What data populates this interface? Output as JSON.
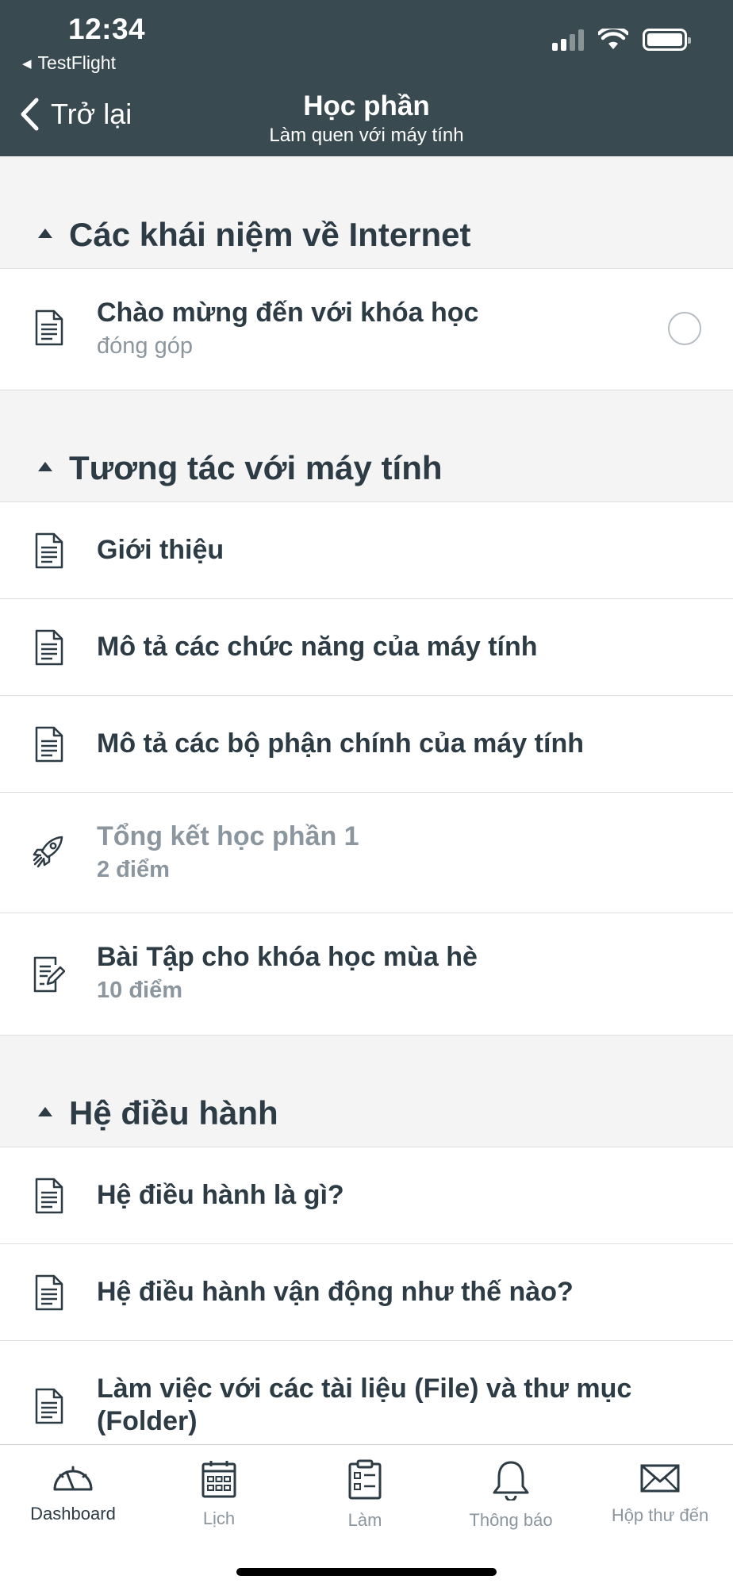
{
  "status_bar": {
    "time": "12:34",
    "back_app": "TestFlight"
  },
  "nav": {
    "back_label": "Trở lại",
    "title": "Học phần",
    "subtitle": "Làm quen với máy tính"
  },
  "sections": [
    {
      "title": "Các khái niệm về Internet",
      "items": [
        {
          "title": "Chào mừng đến với khóa học",
          "subtitle": "đóng góp",
          "icon": "document-icon",
          "has_radio": true
        }
      ]
    },
    {
      "title": "Tương tác với máy tính",
      "items": [
        {
          "title": "Giới thiệu",
          "icon": "document-icon"
        },
        {
          "title": "Mô tả các chức năng của máy tính",
          "icon": "document-icon"
        },
        {
          "title": "Mô tả các bộ phận chính của máy tính",
          "icon": "document-icon"
        },
        {
          "title": "Tổng kết học phần 1",
          "subtitle": "2 điểm",
          "icon": "rocket-icon",
          "dimmed": true
        },
        {
          "title": "Bài Tập cho khóa học mùa hè",
          "subtitle": "10 điểm",
          "icon": "assignment-icon"
        }
      ]
    },
    {
      "title": "Hệ điều hành",
      "items": [
        {
          "title": "Hệ điều hành là gì?",
          "icon": "document-icon"
        },
        {
          "title": "Hệ điều hành vận động như thế nào?",
          "icon": "document-icon"
        },
        {
          "title": "Làm việc với các tài liệu (File) và thư mục (Folder)",
          "icon": "document-icon"
        }
      ]
    }
  ],
  "tabbar": {
    "tabs": [
      {
        "label": "Dashboard",
        "icon": "dashboard-icon",
        "active": true
      },
      {
        "label": "Lịch",
        "icon": "calendar-icon"
      },
      {
        "label": "Làm",
        "icon": "todo-clipboard-icon"
      },
      {
        "label": "Thông báo",
        "icon": "bell-icon"
      },
      {
        "label": "Hộp thư đến",
        "icon": "envelope-icon"
      }
    ]
  },
  "colors": {
    "header_bg": "#394b51",
    "text_primary": "#2d3b45",
    "text_secondary": "#8b969e",
    "page_bg": "#f4f4f4"
  }
}
